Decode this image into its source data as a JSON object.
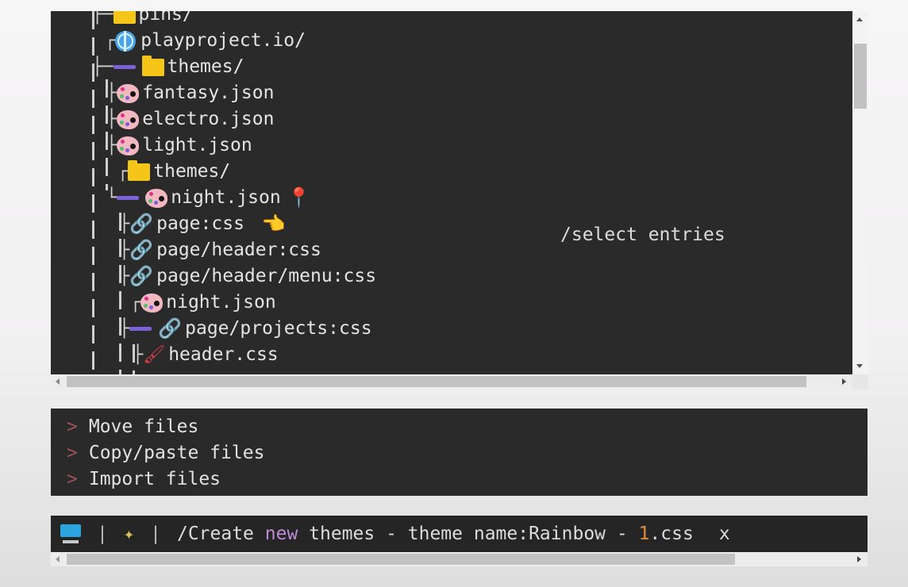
{
  "tree": {
    "rows": [
      {
        "label": "pins/",
        "icon": "folder-icon"
      },
      {
        "label": "playproject.io/",
        "icon": "globe-icon"
      },
      {
        "label": "themes/",
        "icon": "folder-icon"
      },
      {
        "label": "fantasy.json",
        "icon": "palette-icon"
      },
      {
        "label": "electro.json",
        "icon": "palette-icon"
      },
      {
        "label": "light.json",
        "icon": "palette-icon"
      },
      {
        "label": "themes/",
        "icon": "folder-icon"
      },
      {
        "label": "night.json",
        "icon": "palette-icon",
        "badge": "pin-icon"
      },
      {
        "label": "page:css",
        "icon": "link-icon",
        "badge": "pointing-hand-icon"
      },
      {
        "label": "page/header:css",
        "icon": "link-icon"
      },
      {
        "label": "page/header/menu:css",
        "icon": "link-icon"
      },
      {
        "label": "night.json",
        "icon": "palette-icon"
      },
      {
        "label": "page/projects:css",
        "icon": "link-icon"
      },
      {
        "label": "header.css",
        "icon": "paintbrush-icon"
      }
    ],
    "hint": "/select entries",
    "vscroll_position": 0.09,
    "hscroll_position": 0
  },
  "menu": {
    "items": [
      {
        "chevron": ">",
        "label": "Move files"
      },
      {
        "chevron": ">",
        "label": "Copy/paste files"
      },
      {
        "chevron": ">",
        "label": "Import files"
      }
    ]
  },
  "command_bar": {
    "separator": "|",
    "prefix": "/Create ",
    "keyword": "new",
    "middle": " themes - theme name:Rainbow - ",
    "number": "1",
    "suffix": ".css",
    "close": "x"
  },
  "colors": {
    "panel_bg": "#2a2a2a",
    "accent_dash": "#7b62d8",
    "keyword": "#c08bd6",
    "number": "#e28a3b",
    "chevron": "#a0505a"
  }
}
